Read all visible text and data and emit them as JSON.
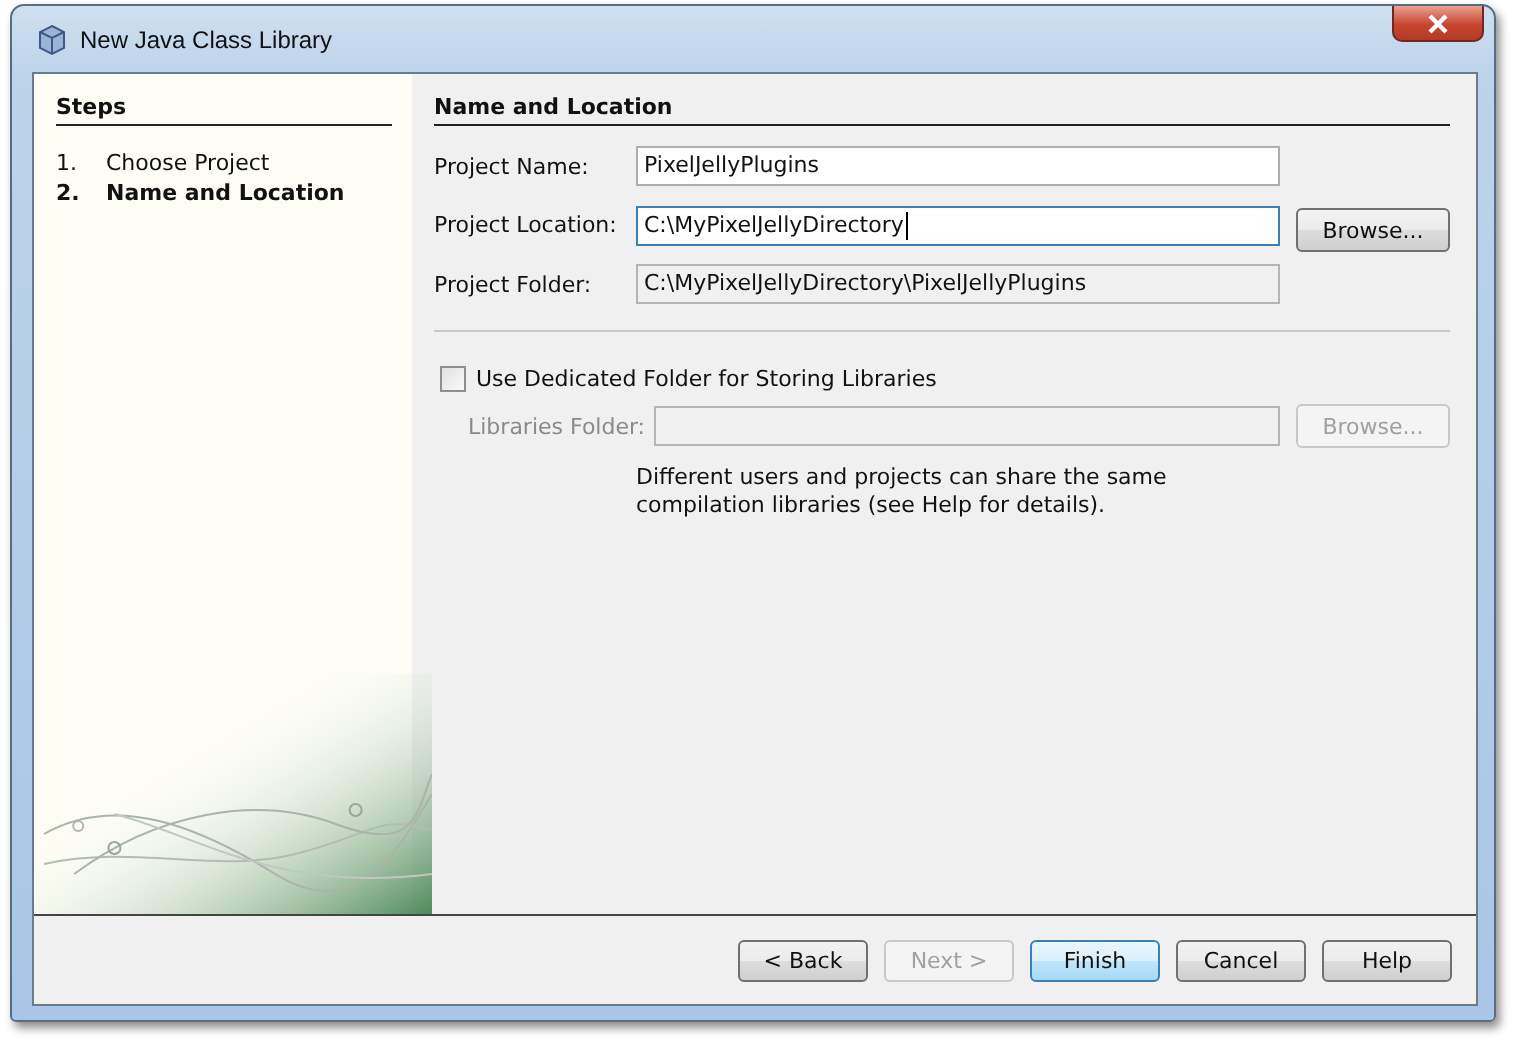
{
  "window": {
    "title": "New Java Class Library"
  },
  "steps": {
    "title": "Steps",
    "items": [
      {
        "number": "1.",
        "label": "Choose Project",
        "selected": false
      },
      {
        "number": "2.",
        "label": "Name and Location",
        "selected": true
      }
    ]
  },
  "panel": {
    "title": "Name and Location",
    "fields": [
      {
        "label": "Project Name:",
        "value": "PixelJellyPlugins",
        "kind": "text",
        "focused": false
      },
      {
        "label": "Project Location:",
        "value": "C:\\MyPixelJellyDirectory",
        "kind": "text",
        "focused": true,
        "button": "Browse..."
      },
      {
        "label": "Project Folder:",
        "value": "C:\\MyPixelJellyDirectory\\PixelJellyPlugins",
        "kind": "readonly"
      }
    ],
    "library_option": {
      "label": "Use Dedicated Folder for Storing Libraries",
      "checked": false
    },
    "libraries_folder": {
      "label": "Libraries Folder:",
      "disabled": true,
      "button": "Browse..."
    },
    "note": "Different users and projects can share the same compilation libraries (see Help for details)."
  },
  "buttons": [
    {
      "label": "< Back",
      "disabled": false,
      "default": false
    },
    {
      "label": "Next >",
      "disabled": true,
      "default": false
    },
    {
      "label": "Finish",
      "disabled": false,
      "default": true
    },
    {
      "label": "Cancel",
      "disabled": false,
      "default": false
    },
    {
      "label": "Help",
      "disabled": false,
      "default": false
    }
  ]
}
